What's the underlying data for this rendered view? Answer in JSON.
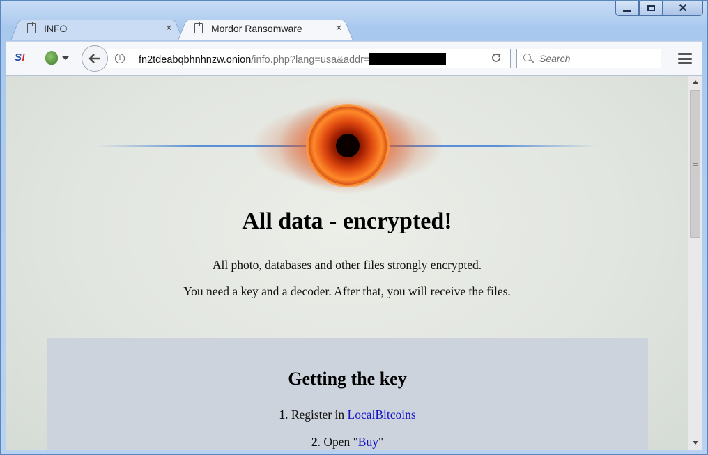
{
  "window": {
    "minimize_label": "—",
    "maximize_label": "☐",
    "close_label": "✕"
  },
  "tabs": [
    {
      "title": "INFO",
      "close": "×"
    },
    {
      "title": "Mordor Ransomware",
      "close": "×"
    }
  ],
  "toolbar": {
    "sj_label": "S",
    "sj_label_accent": "!",
    "url_host": "fn2tdeabqbhnhnzw.onion",
    "url_path": "/info.php?lang=usa&addr=",
    "search_placeholder": "Search"
  },
  "page": {
    "headline": "All data - encrypted!",
    "line1": "All photo, databases and other files strongly encrypted.",
    "line2": "You need a key and a decoder. After that, you will receive the files.",
    "section_title": "Getting the key",
    "steps": [
      {
        "num": "1",
        "prefix": ". Register in ",
        "link": "LocalBitcoins",
        "suffix": ""
      },
      {
        "num": "2",
        "prefix": ". Open \"",
        "link": "Buy",
        "suffix": "\""
      }
    ]
  },
  "colors": {
    "link": "#1515c8",
    "box_bg": "#cdd3dc",
    "eye_orange": "#e8581c"
  }
}
